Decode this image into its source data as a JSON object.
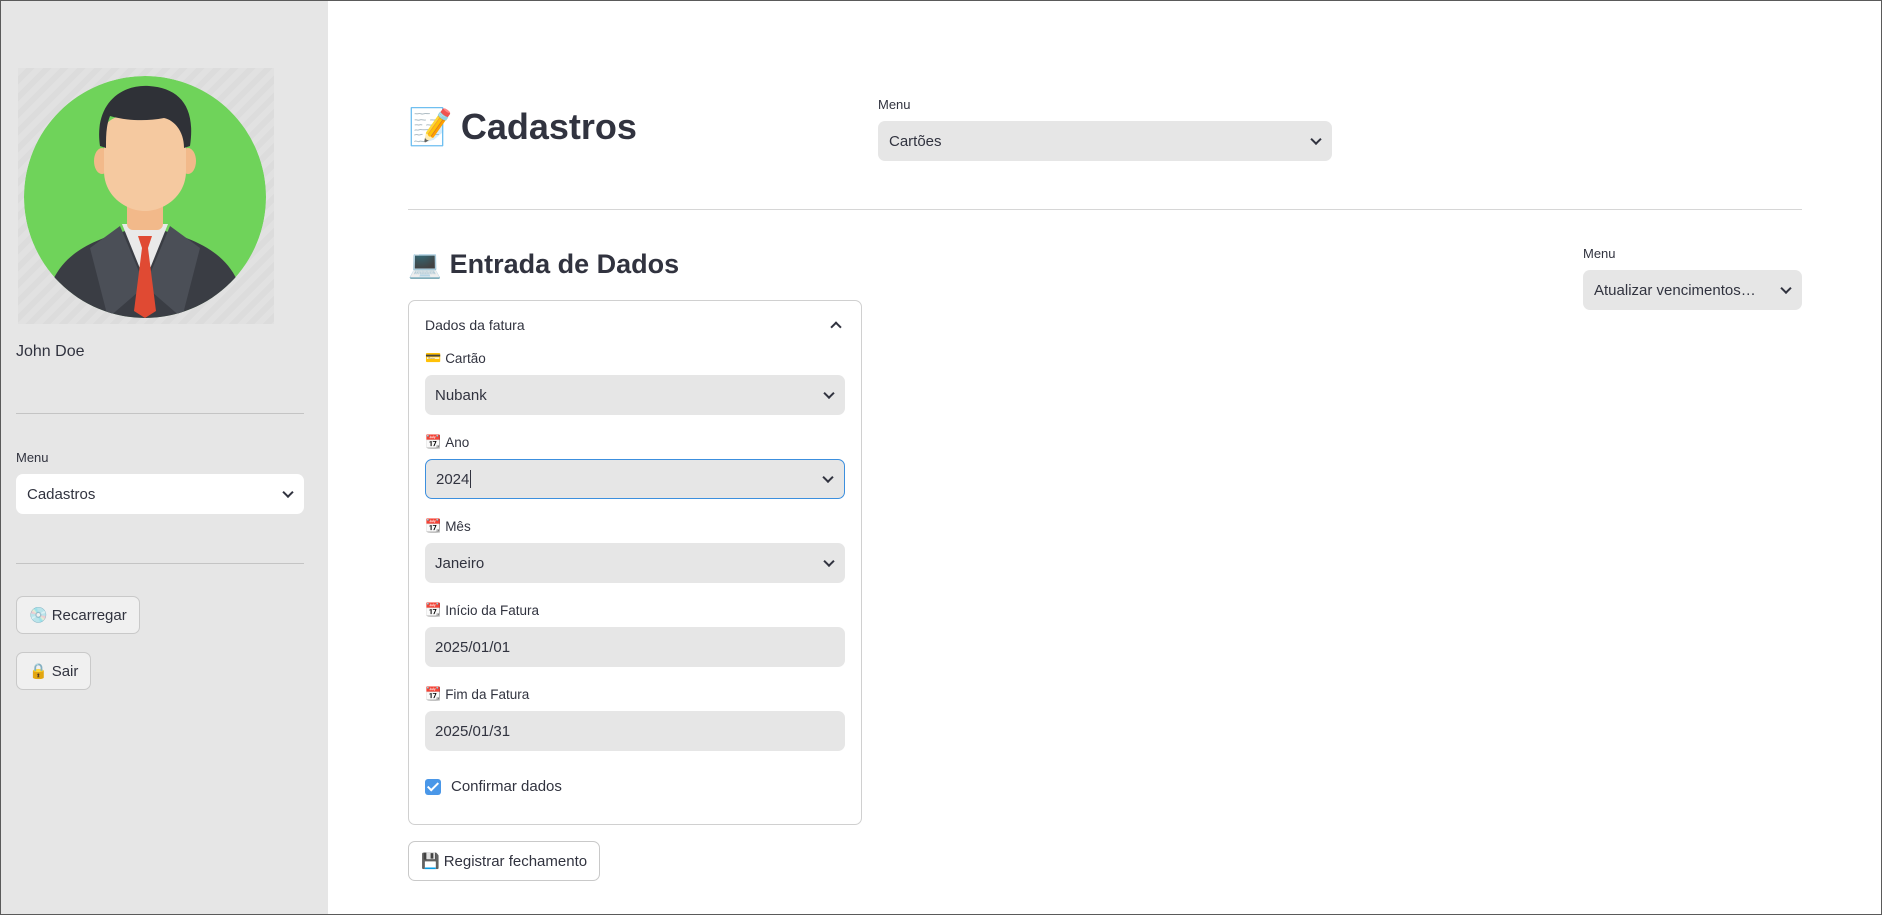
{
  "sidebar": {
    "user_name": "John Doe",
    "menu_label": "Menu",
    "menu_value": "Cadastros",
    "reload_icon": "💿",
    "reload_label": "Recarregar",
    "logout_icon": "🔒",
    "logout_label": "Sair"
  },
  "header": {
    "title_icon": "📝",
    "title": "Cadastros",
    "menu_label": "Menu",
    "menu_value": "Cartões"
  },
  "section": {
    "title_icon": "💻",
    "title": "Entrada de Dados",
    "menu_label": "Menu",
    "menu_value": "Atualizar vencimentos…"
  },
  "expander": {
    "title": "Dados da fatura",
    "fields": [
      {
        "icon": "💳",
        "label": "Cartão",
        "value": "Nubank"
      },
      {
        "icon": "📆",
        "label": "Ano",
        "value": "2024"
      },
      {
        "icon": "📆",
        "label": "Mês",
        "value": "Janeiro"
      },
      {
        "icon": "📆",
        "label": "Início da Fatura",
        "value": "2025/01/01"
      },
      {
        "icon": "📆",
        "label": "Fim da Fatura",
        "value": "2025/01/31"
      }
    ],
    "confirm_label": "Confirmar dados",
    "confirm_checked": true
  },
  "submit": {
    "icon": "💾",
    "label": "Registrar fechamento"
  },
  "colors": {
    "sidebar_bg": "#e6e6e6",
    "avatar_bg": "#6fd35a",
    "accent": "#4a97e8",
    "text": "#31333f"
  }
}
